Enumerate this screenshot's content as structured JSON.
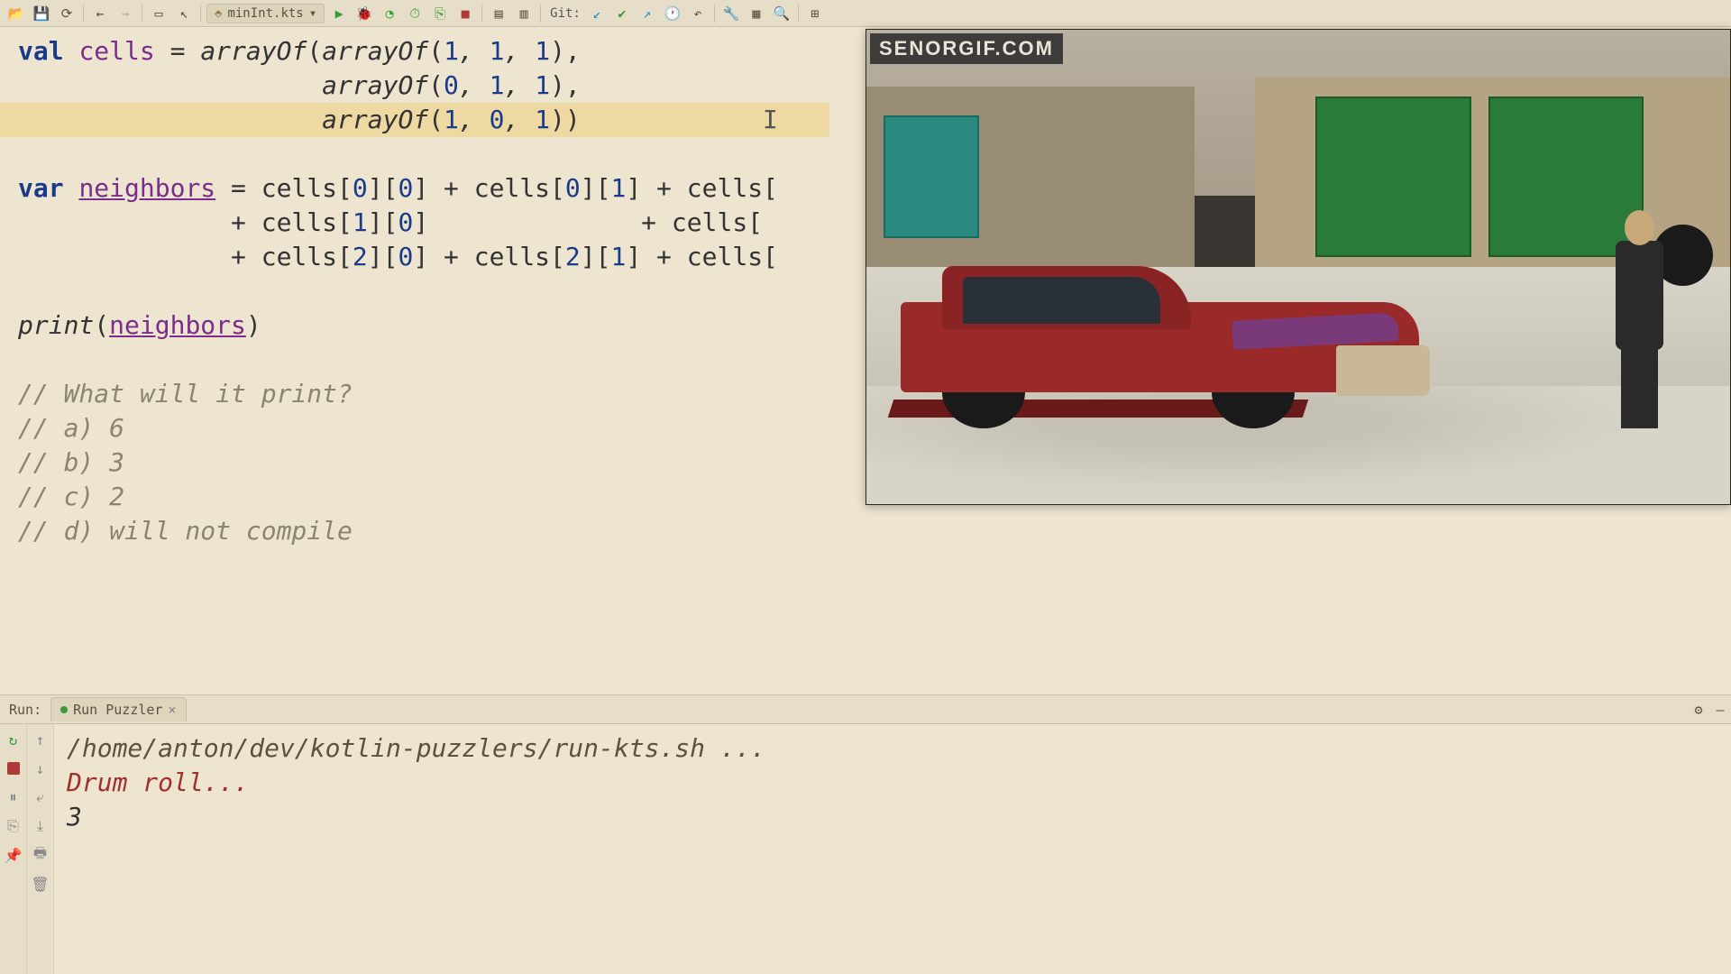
{
  "toolbar": {
    "file_selector": "minInt.kts",
    "git_label": "Git:"
  },
  "code": {
    "l1a": "val",
    "l1b": "cells",
    "l1c": " = ",
    "l1d": "arrayOf",
    "l1e": "(",
    "l1f": "arrayOf",
    "l1g": "(",
    "l1h": "1",
    "l1i": ", ",
    "l1j": "1",
    "l1k": ", ",
    "l1l": "1",
    "l1m": "),",
    "l2a": "                    ",
    "l2b": "arrayOf",
    "l2c": "(",
    "l2d": "0",
    "l2e": ", ",
    "l2f": "1",
    "l2g": ", ",
    "l2h": "1",
    "l2i": "),",
    "l3a": "                    ",
    "l3b": "arrayOf",
    "l3c": "(",
    "l3d": "1",
    "l3e": ", ",
    "l3f": "0",
    "l3g": ", ",
    "l3h": "1",
    "l3i": "))",
    "l3cur": "            I",
    "l4": "",
    "l5a": "var",
    "l5b": " ",
    "l5c": "neighbors",
    "l5d": " = cells[",
    "l5e": "0",
    "l5f": "][",
    "l5g": "0",
    "l5h": "] + cells[",
    "l5i": "0",
    "l5j": "][",
    "l5k": "1",
    "l5l": "] + cells[",
    "l6a": "              + cells[",
    "l6b": "1",
    "l6c": "][",
    "l6d": "0",
    "l6e": "]              + cells[",
    "l7a": "              + cells[",
    "l7b": "2",
    "l7c": "][",
    "l7d": "0",
    "l7e": "] + cells[",
    "l7f": "2",
    "l7g": "][",
    "l7h": "1",
    "l7i": "] + cells[",
    "l8": "",
    "l9a": "print",
    "l9b": "(",
    "l9c": "neighbors",
    "l9d": ")",
    "l10": "",
    "l11": "// What will it print?",
    "l12": "// a) 6",
    "l13": "// b) 3",
    "l14": "// c) 2",
    "l15": "// d) will not compile"
  },
  "overlay": {
    "watermark": "SENORGIF.COM"
  },
  "run": {
    "panel_label": "Run:",
    "tab_label": "Run Puzzler",
    "console_line1": "/home/anton/dev/kotlin-puzzlers/run-kts.sh ...",
    "console_line2": "Drum roll...",
    "console_line3": "3"
  }
}
